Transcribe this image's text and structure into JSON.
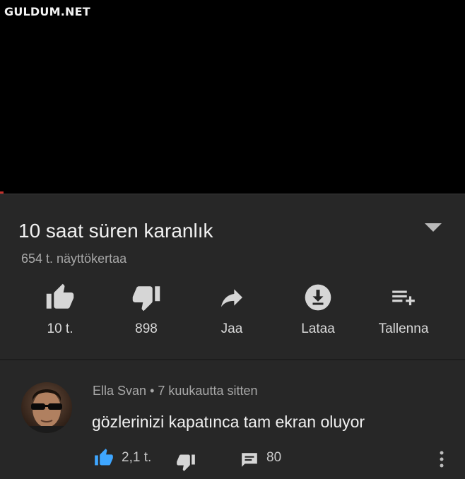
{
  "watermark": "GULDUM.NET",
  "video": {
    "title": "10 saat süren karanlık",
    "views": "654 t. näyttökertaa"
  },
  "actions": [
    {
      "label": "10 t.",
      "icon": "thumbs-up-icon"
    },
    {
      "label": "898",
      "icon": "thumbs-down-icon"
    },
    {
      "label": "Jaa",
      "icon": "share-icon"
    },
    {
      "label": "Lataa",
      "icon": "download-icon"
    },
    {
      "label": "Tallenna",
      "icon": "playlist-add-icon"
    }
  ],
  "comment": {
    "author": "Ella Svan",
    "separator": "•",
    "time": "7 kuukautta sitten",
    "text": "gözlerinizi kapatınca tam ekran oluyor",
    "likes": "2,1 t.",
    "replies": "80"
  },
  "colors": {
    "background": "#272727",
    "video": "#000000",
    "like_active": "#3ea6ff",
    "icon": "#d6d6d6"
  }
}
